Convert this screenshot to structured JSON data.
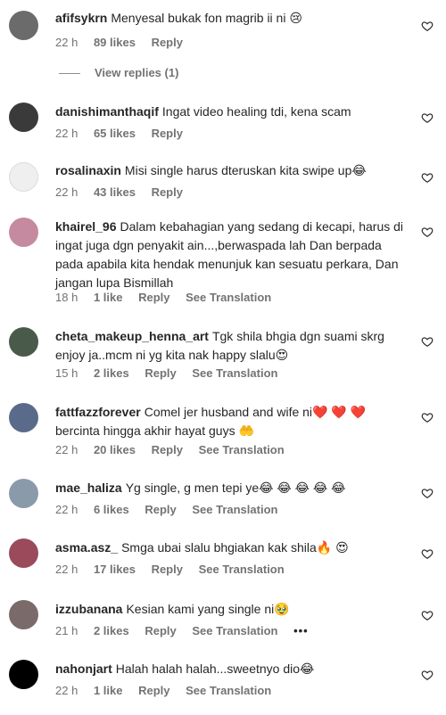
{
  "comments": [
    {
      "user": "afifsykrn",
      "text": "Menyesal bukak fon magrib ii ni 😢",
      "time": "22 h",
      "likes": "89 likes",
      "reply": "Reply",
      "translate": "",
      "avatar": "#6b6b6b"
    },
    {
      "user": "danishimanthaqif",
      "text": "Ingat video healing tdi, kena scam",
      "time": "22 h",
      "likes": "65 likes",
      "reply": "Reply",
      "translate": "",
      "avatar": "#3a3a3a"
    },
    {
      "user": "rosalinaxin",
      "text": "Misi single harus dteruskan kita swipe up😂",
      "time": "22 h",
      "likes": "43 likes",
      "reply": "Reply",
      "translate": "",
      "avatar": "#efefef"
    },
    {
      "user": "khairel_96",
      "text": "Dalam kebahagian yang sedang di kecapi, harus di ingat juga dgn penyakit ain...,berwaspada lah Dan berpada pada apabila kita hendak menunjuk kan sesuatu perkara, Dan jangan lupa Bismillah",
      "time": "18 h",
      "likes": "1 like",
      "reply": "Reply",
      "translate": "See Translation",
      "avatar": "#c58aa0"
    },
    {
      "user": "cheta_makeup_henna_art",
      "text": "Tgk shila bhgia dgn suami skrg enjoy ja..mcm ni yg kita nak happy slalu😍",
      "time": "15 h",
      "likes": "2 likes",
      "reply": "Reply",
      "translate": "See Translation",
      "avatar": "#4a5a4a"
    },
    {
      "user": "fattfazzforever",
      "text": "Comel jer husband and wife ni❤️ ❤️ ❤️ bercinta hingga akhir hayat guys 🤲",
      "time": "22 h",
      "likes": "20 likes",
      "reply": "Reply",
      "translate": "See Translation",
      "avatar": "#5a6a8a"
    },
    {
      "user": "mae_haliza",
      "text": "Yg single, g men tepi ye😂 😂 😂 😂 😂",
      "time": "22 h",
      "likes": "6 likes",
      "reply": "Reply",
      "translate": "See Translation",
      "avatar": "#8a9aaa"
    },
    {
      "user": "asma.asz_",
      "text": "Smga ubai slalu bhgiakan kak shila🔥 😍",
      "time": "22 h",
      "likes": "17 likes",
      "reply": "Reply",
      "translate": "See Translation",
      "avatar": "#9a4a5a"
    },
    {
      "user": "izzubanana",
      "text": "Kesian kami yang single ni🥹",
      "time": "21 h",
      "likes": "2 likes",
      "reply": "Reply",
      "translate": "See Translation",
      "avatar": "#7a6a6a"
    },
    {
      "user": "nahonjart",
      "text": "Halah halah halah...sweetnyo dio😂",
      "time": "22 h",
      "likes": "1 like",
      "reply": "Reply",
      "translate": "See Translation",
      "avatar": "#000000"
    }
  ],
  "view_replies": "View replies (1)",
  "more": "•••"
}
